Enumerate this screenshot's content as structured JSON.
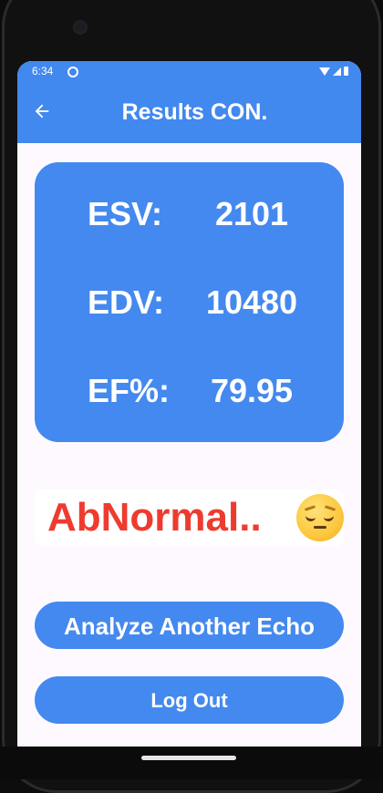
{
  "status_bar": {
    "time": "6:34"
  },
  "app_bar": {
    "title": "Results CON."
  },
  "results": [
    {
      "label": "ESV:",
      "value": "2101"
    },
    {
      "label": "EDV:",
      "value": "10480"
    },
    {
      "label": "EF%:",
      "value": "79.95"
    }
  ],
  "status": {
    "text": "AbNormal..",
    "icon": "pensive-face-emoji",
    "color": "#ee3b30"
  },
  "buttons": {
    "analyze": "Analyze Another Echo",
    "logout": "Log Out"
  },
  "colors": {
    "primary": "#4188ef",
    "background": "#fdf9ff"
  }
}
